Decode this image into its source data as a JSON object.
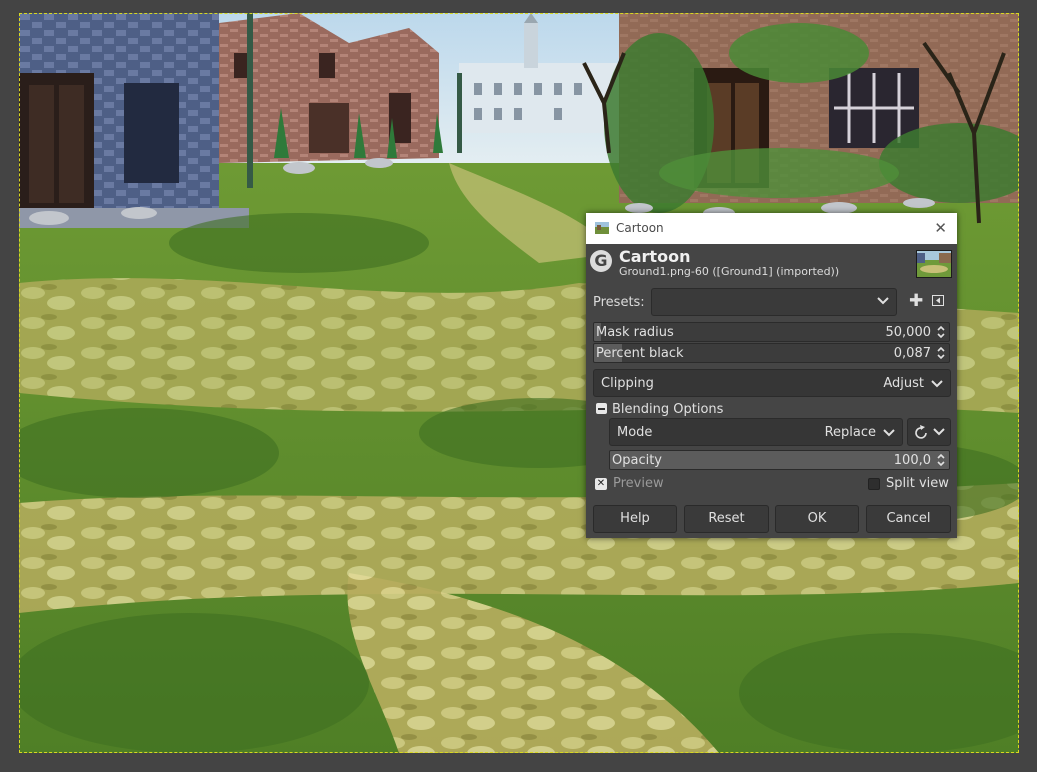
{
  "dialog": {
    "window_title": "Cartoon",
    "title": "Cartoon",
    "subtitle": "Ground1.png-60 ([Ground1] (imported))",
    "close_icon": "close-icon",
    "logo_icon": "gimp-g-logo-icon",
    "presets": {
      "label": "Presets:",
      "value": "",
      "add_icon": "plus-icon",
      "menu_icon": "menu-arrow-icon"
    },
    "mask_radius": {
      "label": "Mask radius",
      "value": "50,000",
      "fill_fraction": 0.02
    },
    "percent_black": {
      "label": "Percent black",
      "value": "0,087",
      "fill_fraction": 0.08
    },
    "clipping": {
      "label": "Clipping",
      "value": "Adjust"
    },
    "blending": {
      "label": "Blending Options",
      "expanded": true,
      "mode": {
        "label": "Mode",
        "value": "Replace"
      },
      "opacity": {
        "label": "Opacity",
        "value": "100,0",
        "fill_fraction": 1.0
      }
    },
    "preview": {
      "label": "Preview",
      "checked": true
    },
    "split_view": {
      "label": "Split view",
      "checked": false
    },
    "buttons": {
      "help": "Help",
      "reset": "Reset",
      "ok": "OK",
      "cancel": "Cancel"
    }
  },
  "colors": {
    "workspace_bg": "#444444",
    "dialog_bg": "#454545",
    "selection_marquee": "#d8d820"
  }
}
